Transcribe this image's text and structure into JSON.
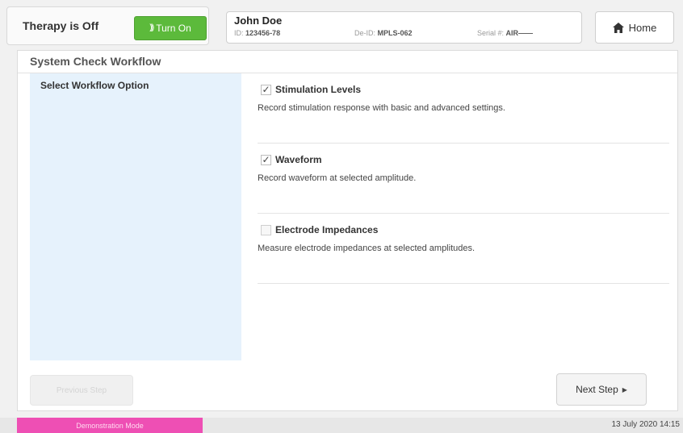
{
  "header": {
    "therapy_status": "Therapy is Off",
    "turn_on_label": "Turn On",
    "home_label": "Home"
  },
  "patient": {
    "name": "John Doe",
    "id_label": "ID:",
    "id_value": "123456-78",
    "deid_label": "De-ID:",
    "deid_value": "MPLS-062",
    "serial_label": "Serial #:",
    "serial_value": "AIR——"
  },
  "workflow": {
    "title": "System Check Workflow",
    "sidebar_heading": "Select Workflow Option",
    "options": [
      {
        "label": "Stimulation Levels",
        "description": "Record stimulation response with basic and advanced settings.",
        "checked": true
      },
      {
        "label": "Waveform",
        "description": "Record waveform at selected amplitude.",
        "checked": true
      },
      {
        "label": "Electrode Impedances",
        "description": "Measure electrode impedances at selected amplitudes.",
        "checked": false
      }
    ]
  },
  "buttons": {
    "previous_label": "Previous Step",
    "next_label": "Next Step"
  },
  "footer": {
    "mode": "Demonstration Mode",
    "datetime": "13 July 2020 14:15"
  },
  "colors": {
    "turn_on_green": "#5cba3b",
    "sidebar_blue": "#e6f2fc",
    "demo_pink": "#ee4fb4"
  },
  "icons": {
    "turn_on": "wireless-wave-icon",
    "home": "home-icon",
    "next": "play-arrow-icon",
    "check": "checkmark-icon"
  }
}
